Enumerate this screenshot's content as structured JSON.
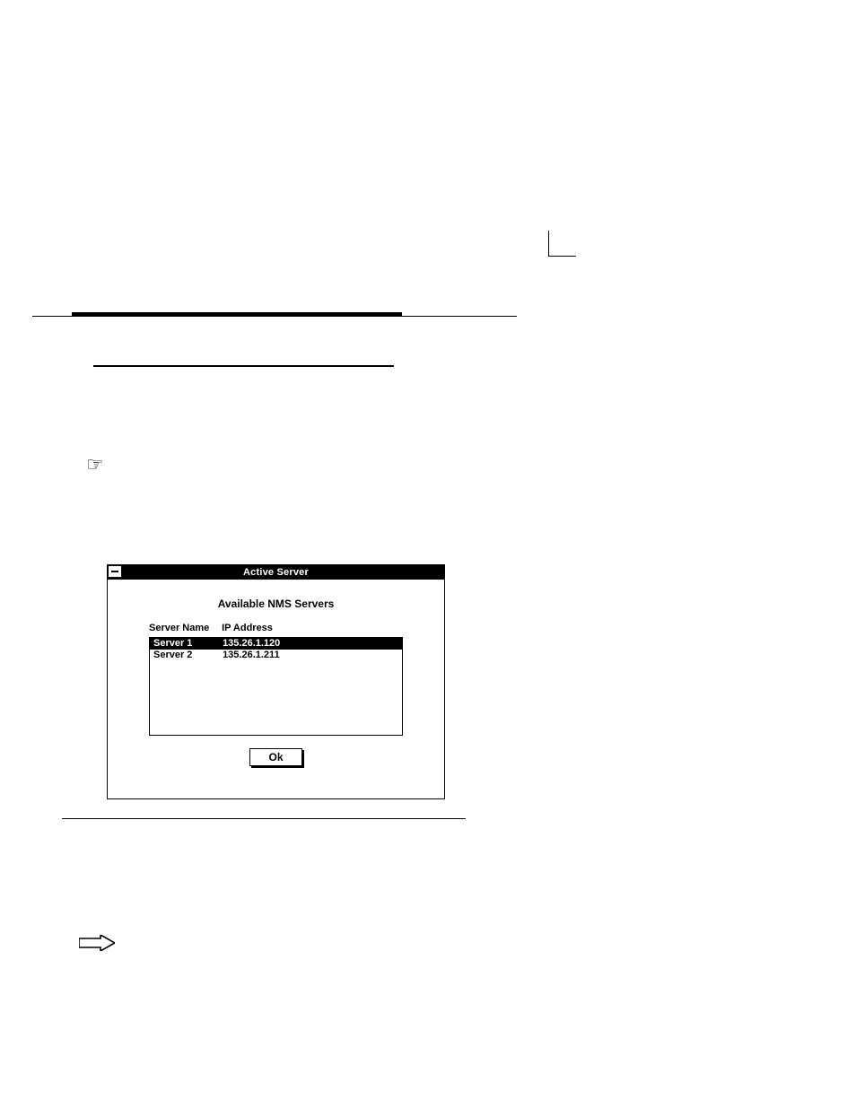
{
  "dialog": {
    "title": "Active Server",
    "subtitle": "Available NMS Servers",
    "columns": {
      "name": "Server Name",
      "ip": "IP Address"
    },
    "rows": [
      {
        "name": "Server 1",
        "ip": "135.26.1.120",
        "selected": true
      },
      {
        "name": "Server 2",
        "ip": "135.26.1.211",
        "selected": false
      }
    ],
    "ok_label": "Ok"
  }
}
